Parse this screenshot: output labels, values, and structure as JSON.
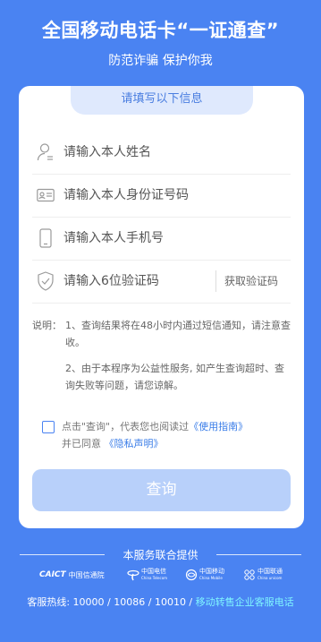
{
  "header": {
    "title": "全国移动电话卡“一证通查”",
    "subtitle": "防范诈骗 保护你我"
  },
  "form": {
    "tab_label": "请填写以下信息",
    "name_placeholder": "请输入本人姓名",
    "id_placeholder": "请输入本人身份证号码",
    "phone_placeholder": "请输入本人手机号",
    "code_placeholder": "请输入6位验证码",
    "get_code_label": "获取验证码"
  },
  "notes": {
    "label": "说明：",
    "items": [
      "1、查询结果将在48小时内通过短信通知，请注意查收。",
      "2、由于本程序为公益性服务, 如产生查询超时、查询失败等问题，请您谅解。"
    ]
  },
  "agreement": {
    "prefix": "点击\"查询\"，代表您也阅读过",
    "guide_link": "《使用指南》",
    "middle": "并已同意",
    "privacy_link": "《隐私声明》"
  },
  "query_button": "查询",
  "footer": {
    "provider_text": "本服务联合提供",
    "logos": {
      "caict_mark": "CAICT",
      "caict_name": "中国信通院",
      "telecom_cn": "中国电信",
      "telecom_en": "China Telecom",
      "mobile_cn": "中国移动",
      "mobile_en": "China Mobile",
      "unicom_cn": "中国联通",
      "unicom_en": "China unicom"
    },
    "hotline_prefix": "客服热线: 10000 / 10086 / 10010 / ",
    "hotline_link": "移动转售企业客服电话"
  },
  "colors": {
    "background": "#4a83f2",
    "button_disabled": "#b8d0fa",
    "link": "#3a7de8",
    "footer_link": "#7ff5ff"
  },
  "icons": [
    "person-icon",
    "id-card-icon",
    "phone-icon",
    "shield-check-icon",
    "checkbox"
  ]
}
